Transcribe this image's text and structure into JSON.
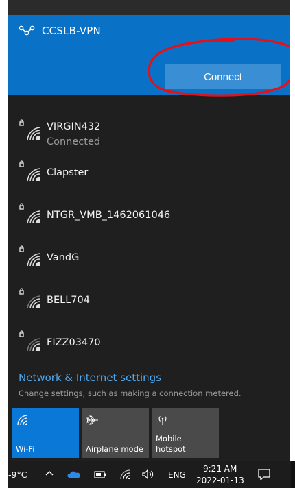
{
  "vpn": {
    "name": "CCSLB-VPN",
    "connect_label": "Connect",
    "icon": "vpn-icon",
    "accent": "#0a72c6",
    "annotation_color": "#e0121b"
  },
  "networks": [
    {
      "name": "VIRGIN432",
      "status": "Connected",
      "icon": "secured-wifi-icon"
    },
    {
      "name": "Clapster",
      "status": "",
      "icon": "secured-wifi-icon"
    },
    {
      "name": "NTGR_VMB_1462061046",
      "status": "",
      "icon": "secured-wifi-icon"
    },
    {
      "name": "VandG",
      "status": "",
      "icon": "secured-wifi-icon"
    },
    {
      "name": "BELL704",
      "status": "",
      "icon": "secured-wifi-icon"
    },
    {
      "name": "FIZZ03470",
      "status": "",
      "icon": "secured-wifi-icon"
    }
  ],
  "settings": {
    "link": "Network & Internet settings",
    "description": "Change settings, such as making a connection metered."
  },
  "quick_actions": {
    "wifi": {
      "label": "Wi-Fi",
      "active": true,
      "icon": "wifi-icon"
    },
    "airplane": {
      "label": "Airplane mode",
      "active": false,
      "icon": "airplane-icon"
    },
    "hotspot": {
      "label_line1": "Mobile",
      "label_line2": "hotspot",
      "active": false,
      "icon": "hotspot-icon"
    }
  },
  "taskbar": {
    "temperature": "-9°C",
    "language": "ENG",
    "time": "9:21 AM",
    "date": "2022-01-13",
    "icons": [
      "chevron-up-icon",
      "onedrive-icon",
      "battery-icon",
      "wifi-icon",
      "volume-icon",
      "notification-icon"
    ]
  }
}
